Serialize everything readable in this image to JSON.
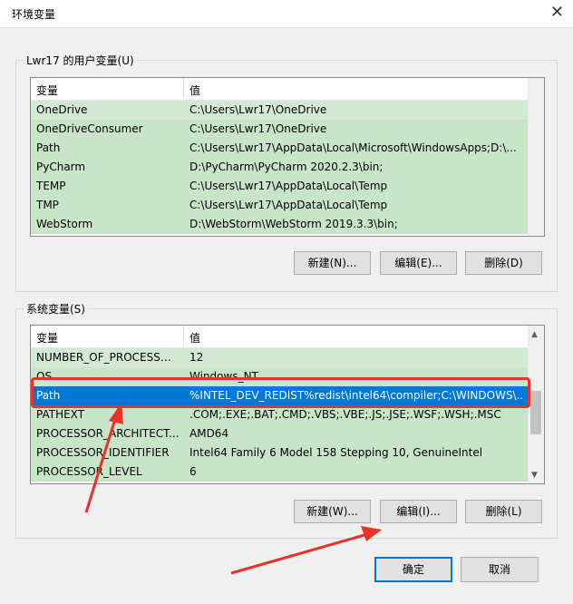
{
  "window": {
    "title": "环境变量",
    "close_icon": "close-icon"
  },
  "user_vars": {
    "group_label": "Lwr17 的用户变量(U)",
    "col_variable": "变量",
    "col_value": "值",
    "rows": [
      {
        "name": "OneDrive",
        "value": "C:\\Users\\Lwr17\\OneDrive"
      },
      {
        "name": "OneDriveConsumer",
        "value": "C:\\Users\\Lwr17\\OneDrive"
      },
      {
        "name": "Path",
        "value": "C:\\Users\\Lwr17\\AppData\\Local\\Microsoft\\WindowsApps;D:\\..."
      },
      {
        "name": "PyCharm",
        "value": "D:\\PyCharm\\PyCharm 2020.2.3\\bin;"
      },
      {
        "name": "TEMP",
        "value": "C:\\Users\\Lwr17\\AppData\\Local\\Temp"
      },
      {
        "name": "TMP",
        "value": "C:\\Users\\Lwr17\\AppData\\Local\\Temp"
      },
      {
        "name": "WebStorm",
        "value": "D:\\WebStorm\\WebStorm 2019.3.3\\bin;"
      }
    ],
    "buttons": {
      "new": "新建(N)...",
      "edit": "编辑(E)...",
      "delete": "删除(D)"
    }
  },
  "system_vars": {
    "group_label": "系统变量(S)",
    "col_variable": "变量",
    "col_value": "值",
    "rows": [
      {
        "name": "NUMBER_OF_PROCESSORS",
        "value": "12"
      },
      {
        "name": "OS",
        "value": "Windows_NT"
      },
      {
        "name": "Path",
        "value": "%INTEL_DEV_REDIST%redist\\intel64\\compiler;C:\\WINDOWS\\..."
      },
      {
        "name": "PATHEXT",
        "value": ".COM;.EXE;.BAT;.CMD;.VBS;.VBE;.JS;.JSE;.WSF;.WSH;.MSC"
      },
      {
        "name": "PROCESSOR_ARCHITECT...",
        "value": "AMD64"
      },
      {
        "name": "PROCESSOR_IDENTIFIER",
        "value": "Intel64 Family 6 Model 158 Stepping 10, GenuineIntel"
      },
      {
        "name": "PROCESSOR_LEVEL",
        "value": "6"
      }
    ],
    "selected_row": "Path",
    "buttons": {
      "new": "新建(W)...",
      "edit": "编辑(I)...",
      "delete": "删除(L)"
    }
  },
  "footer": {
    "ok": "确定",
    "cancel": "取消"
  },
  "colors": {
    "accent": "#0078d7",
    "row_bg": "#c9e5c9",
    "annotation": "#e8332a"
  }
}
